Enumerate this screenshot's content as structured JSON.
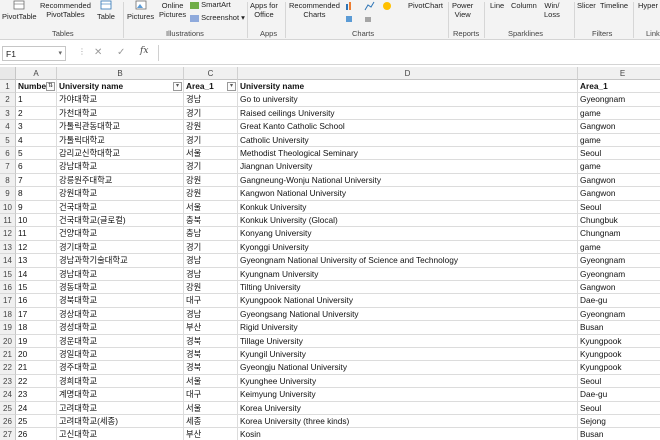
{
  "ribbon": {
    "items": {
      "pivottable": "PivotTable",
      "recommended_pivottables": [
        "Recommended",
        "PivotTables"
      ],
      "table": "Table",
      "pictures": "Pictures",
      "online_pictures": [
        "Online",
        "Pictures"
      ],
      "smartart": "SmartArt",
      "screenshot": "Screenshot",
      "apps_for_office": [
        "Apps for",
        "Office"
      ],
      "recommended_charts": [
        "Recommended",
        "Charts"
      ],
      "pivotchart": "PivotChart",
      "power_view": [
        "Power",
        "View"
      ],
      "line": "Line",
      "column": "Column",
      "win_loss": [
        "Win/",
        "Loss"
      ],
      "slicer": "Slicer",
      "timeline": "Timeline",
      "hyperlink": "Hyper"
    },
    "groups": {
      "tables": "Tables",
      "illustrations": "Illustrations",
      "apps": "Apps",
      "charts": "Charts",
      "reports": "Reports",
      "sparklines": "Sparklines",
      "filters": "Filters",
      "links": "Link"
    }
  },
  "formula_bar": {
    "name_box": "F1",
    "value": ""
  },
  "sheet": {
    "columns": [
      "A",
      "B",
      "C",
      "D",
      "E"
    ],
    "header_row": [
      "Number",
      "University name",
      "Area_1",
      "University name",
      "Area_1"
    ],
    "rows": [
      [
        "1",
        "가야대학교",
        "경남",
        "Go to university",
        "Gyeongnam"
      ],
      [
        "2",
        "가천대학교",
        "경기",
        "Raised ceilings University",
        "game"
      ],
      [
        "3",
        "가톨릭관동대학교",
        "강원",
        "Great Kanto Catholic School",
        "Gangwon"
      ],
      [
        "4",
        "가톨릭대학교",
        "경기",
        "Catholic University",
        "game"
      ],
      [
        "5",
        "감리교신학대학교",
        "서울",
        "Methodist Theological Seminary",
        "Seoul"
      ],
      [
        "6",
        "강남대학교",
        "경기",
        "Jiangnan University",
        "game"
      ],
      [
        "7",
        "강릉원주대학교",
        "강원",
        "Gangneung-Wonju National University",
        "Gangwon"
      ],
      [
        "8",
        "강원대학교",
        "강원",
        "Kangwon National University",
        "Gangwon"
      ],
      [
        "9",
        "건국대학교",
        "서울",
        "Konkuk University",
        "Seoul"
      ],
      [
        "10",
        "건국대학교(글로컬)",
        "충북",
        "Konkuk University (Glocal)",
        "Chungbuk"
      ],
      [
        "11",
        "건양대학교",
        "충남",
        "Konyang University",
        "Chungnam"
      ],
      [
        "12",
        "경기대학교",
        "경기",
        "Kyonggi University",
        "game"
      ],
      [
        "13",
        "경남과학기술대학교",
        "경남",
        "Gyeongnam National University of Science and Technology",
        "Gyeongnam"
      ],
      [
        "14",
        "경남대학교",
        "경남",
        "Kyungnam University",
        "Gyeongnam"
      ],
      [
        "15",
        "경동대학교",
        "강원",
        "Tilting University",
        "Gangwon"
      ],
      [
        "16",
        "경북대학교",
        "대구",
        "Kyungpook National University",
        "Dae-gu"
      ],
      [
        "17",
        "경상대학교",
        "경남",
        "Gyeongsang National University",
        "Gyeongnam"
      ],
      [
        "18",
        "경성대학교",
        "부산",
        "Rigid University",
        "Busan"
      ],
      [
        "19",
        "경운대학교",
        "경북",
        "Tillage University",
        "Kyungpook"
      ],
      [
        "20",
        "경일대학교",
        "경북",
        "Kyungil University",
        "Kyungpook"
      ],
      [
        "21",
        "경주대학교",
        "경북",
        "Gyeongju National University",
        "Kyungpook"
      ],
      [
        "22",
        "경희대학교",
        "서울",
        "Kyunghee University",
        "Seoul"
      ],
      [
        "23",
        "계명대학교",
        "대구",
        "Keimyung University",
        "Dae-gu"
      ],
      [
        "24",
        "고려대학교",
        "서울",
        "Korea University",
        "Seoul"
      ],
      [
        "25",
        "고려대학교(세종)",
        "세종",
        "Korea University (three kinds)",
        "Sejong"
      ],
      [
        "26",
        "고신대학교",
        "부산",
        "Kosin",
        "Busan"
      ]
    ]
  },
  "colors": {
    "grid_line": "#dcdcdc",
    "header_bg": "#f0f0f0"
  }
}
